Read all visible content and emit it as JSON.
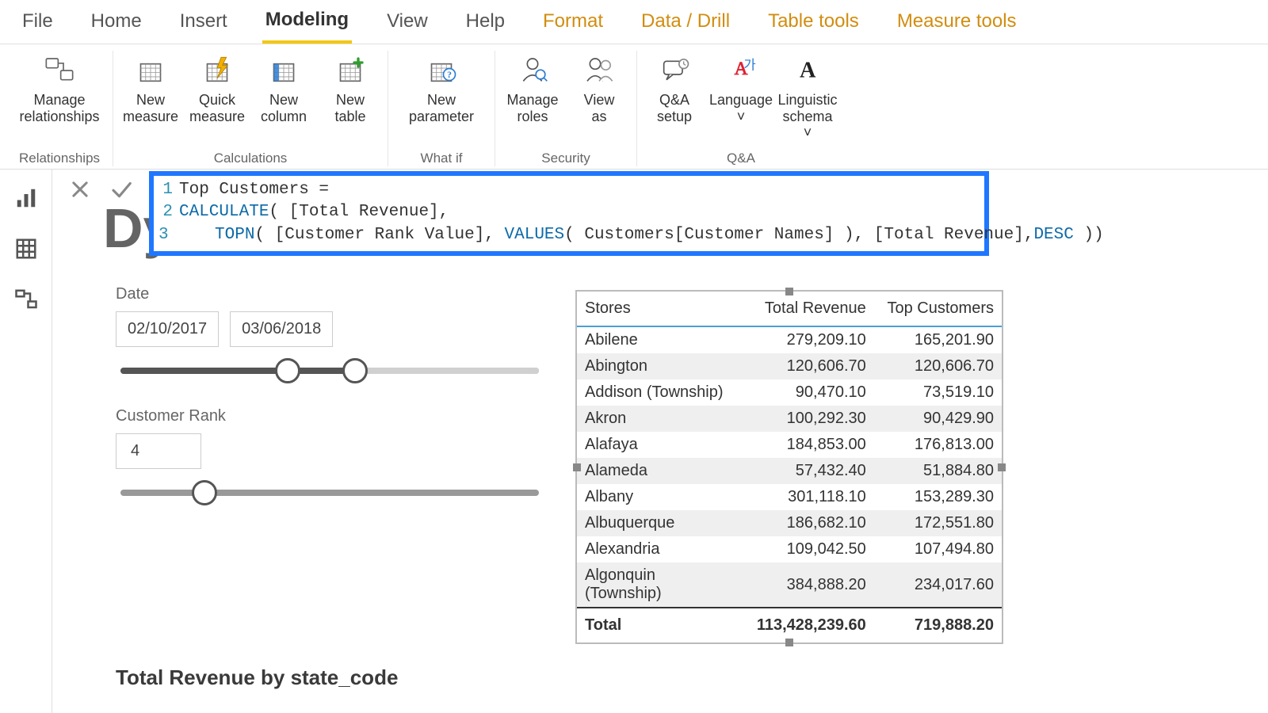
{
  "menu": {
    "tabs": [
      "File",
      "Home",
      "Insert",
      "Modeling",
      "View",
      "Help",
      "Format",
      "Data / Drill",
      "Table tools",
      "Measure tools"
    ],
    "active_index": 3,
    "brand_start_index": 6
  },
  "ribbon": {
    "groups": [
      {
        "label": "Relationships",
        "buttons": [
          {
            "l1": "Manage",
            "l2": "relationships",
            "icon": "relationships-icon",
            "wide": true
          }
        ]
      },
      {
        "label": "Calculations",
        "buttons": [
          {
            "l1": "New",
            "l2": "measure",
            "icon": "new-measure-icon"
          },
          {
            "l1": "Quick",
            "l2": "measure",
            "icon": "quick-measure-icon"
          },
          {
            "l1": "New",
            "l2": "column",
            "icon": "new-column-icon"
          },
          {
            "l1": "New",
            "l2": "table",
            "icon": "new-table-icon"
          }
        ]
      },
      {
        "label": "What if",
        "buttons": [
          {
            "l1": "New",
            "l2": "parameter",
            "icon": "new-parameter-icon",
            "wide": true
          }
        ]
      },
      {
        "label": "Security",
        "buttons": [
          {
            "l1": "Manage",
            "l2": "roles",
            "icon": "manage-roles-icon"
          },
          {
            "l1": "View",
            "l2": "as",
            "icon": "view-as-icon"
          }
        ]
      },
      {
        "label": "Q&A",
        "buttons": [
          {
            "l1": "Q&A",
            "l2": "setup",
            "icon": "qa-setup-icon"
          },
          {
            "l1": "Language",
            "l2": "",
            "icon": "language-icon",
            "caret": true
          },
          {
            "l1": "Linguistic",
            "l2": "schema",
            "icon": "linguistic-schema-icon",
            "caret": true
          }
        ]
      }
    ]
  },
  "left_nav": [
    "report-view-icon",
    "data-view-icon",
    "model-view-icon"
  ],
  "formula": {
    "lines": [
      {
        "n": "1",
        "plain": "Top Customers ="
      },
      {
        "n": "2",
        "seg": [
          {
            "t": "CALCULATE",
            "c": "fn"
          },
          {
            "t": "( [Total Revenue],"
          }
        ]
      },
      {
        "n": "3",
        "seg": [
          {
            "t": "    "
          },
          {
            "t": "TOPN",
            "c": "fn"
          },
          {
            "t": "( [Customer Rank Value], "
          },
          {
            "t": "VALUES",
            "c": "fn"
          },
          {
            "t": "( Customers[Customer Names] ), [Total Revenue],"
          },
          {
            "t": "DESC",
            "c": "desc"
          },
          {
            "t": " ))"
          }
        ]
      }
    ],
    "cancel_tooltip": "Cancel",
    "commit_tooltip": "Commit"
  },
  "background_title": "Dy",
  "slicers": {
    "date": {
      "label": "Date",
      "from": "02/10/2017",
      "to": "03/06/2018",
      "handle1_pct": 40,
      "handle2_pct": 56,
      "fill_from_pct": 0,
      "fill_to_pct": 56
    },
    "rank": {
      "label": "Customer Rank",
      "value": "4",
      "handle_pct": 20
    }
  },
  "table": {
    "headers": [
      "Stores",
      "Total Revenue",
      "Top Customers"
    ],
    "rows": [
      [
        "Abilene",
        "279,209.10",
        "165,201.90"
      ],
      [
        "Abington",
        "120,606.70",
        "120,606.70"
      ],
      [
        "Addison (Township)",
        "90,470.10",
        "73,519.10"
      ],
      [
        "Akron",
        "100,292.30",
        "90,429.90"
      ],
      [
        "Alafaya",
        "184,853.00",
        "176,813.00"
      ],
      [
        "Alameda",
        "57,432.40",
        "51,884.80"
      ],
      [
        "Albany",
        "301,118.10",
        "153,289.30"
      ],
      [
        "Albuquerque",
        "186,682.10",
        "172,551.80"
      ],
      [
        "Alexandria",
        "109,042.50",
        "107,494.80"
      ],
      [
        "Algonquin (Township)",
        "384,888.20",
        "234,017.60"
      ]
    ],
    "total_row": [
      "Total",
      "113,428,239.60",
      "719,888.20"
    ]
  },
  "chart_title": "Total Revenue by state_code"
}
